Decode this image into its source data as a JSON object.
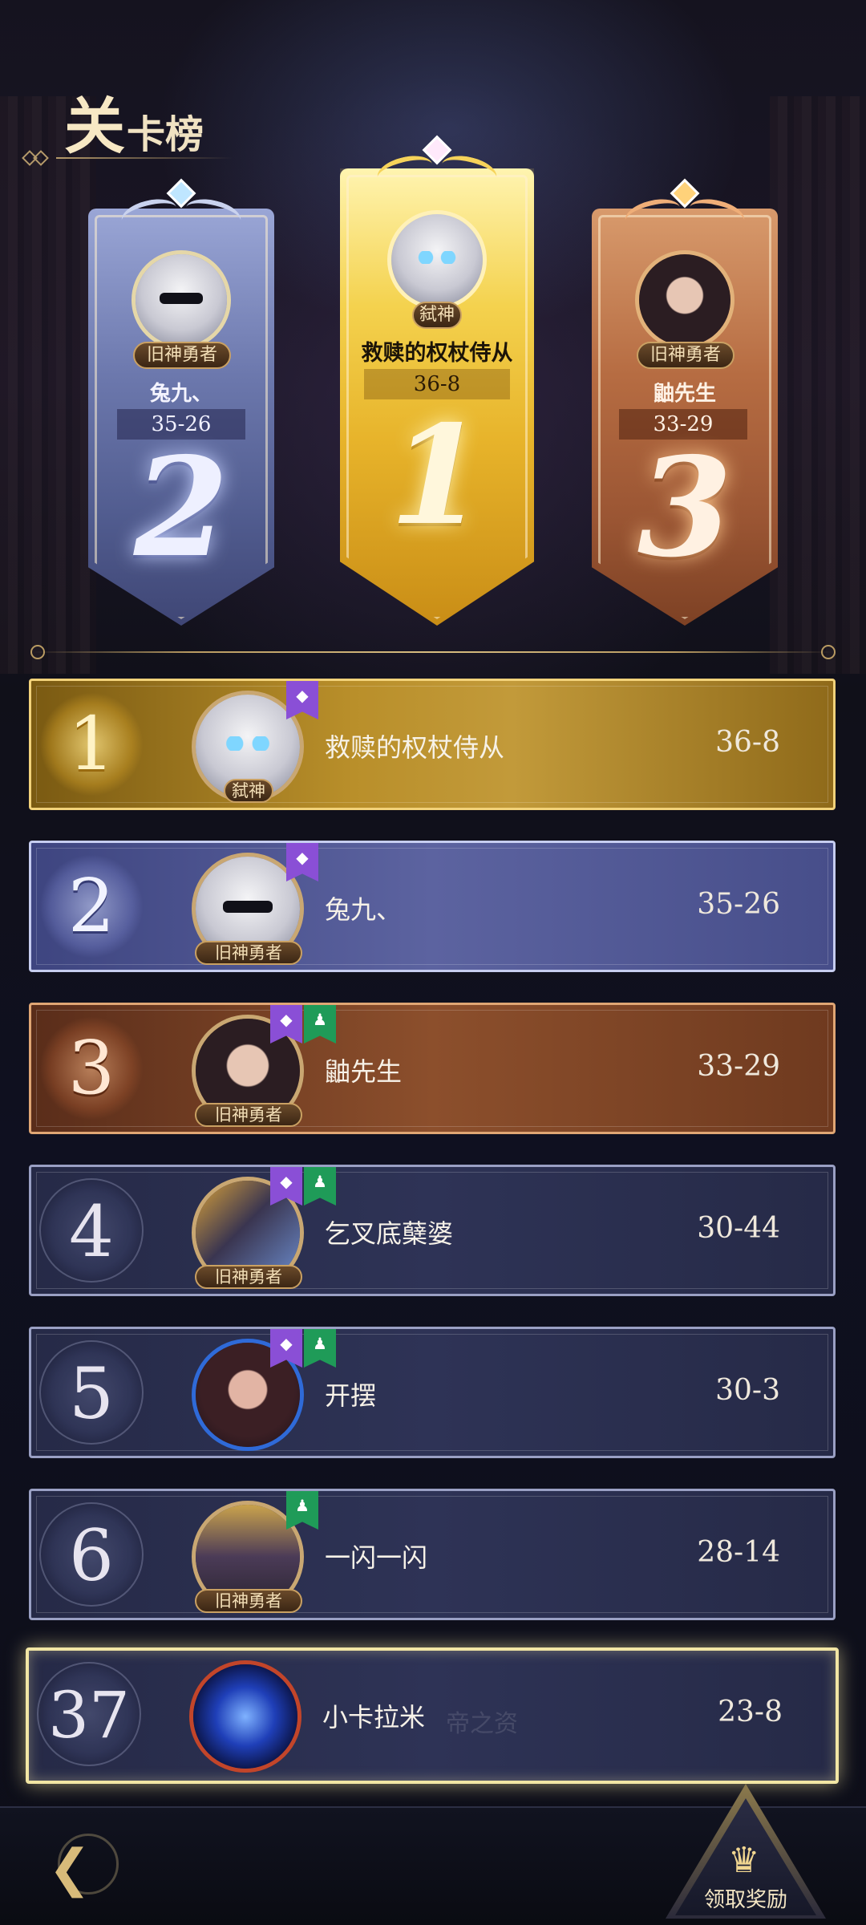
{
  "header": {
    "title_big": "关",
    "title_small": "卡榜"
  },
  "podium": [
    {
      "rank": "1",
      "name": "救赎的权杖侍从",
      "score": "36-8",
      "tag": "弑神",
      "avatar": "white-hair-blue-eyes"
    },
    {
      "rank": "2",
      "name": "兔九、",
      "score": "35-26",
      "tag": "旧神勇者",
      "avatar": "white-hair-sunglasses"
    },
    {
      "rank": "3",
      "name": "鼬先生",
      "score": "33-29",
      "tag": "旧神勇者",
      "avatar": "dark-hair-woman"
    }
  ],
  "leaderboard": [
    {
      "rank": "1",
      "name": "救赎的权杖侍从",
      "score": "36-8",
      "tag": "弑神",
      "badges": [
        "purple"
      ]
    },
    {
      "rank": "2",
      "name": "兔九、",
      "score": "35-26",
      "tag": "旧神勇者",
      "badges": [
        "purple"
      ]
    },
    {
      "rank": "3",
      "name": "鼬先生",
      "score": "33-29",
      "tag": "旧神勇者",
      "badges": [
        "purple",
        "green"
      ]
    },
    {
      "rank": "4",
      "name": "乞叉底蘖婆",
      "score": "30-44",
      "tag": "旧神勇者",
      "badges": [
        "purple",
        "green"
      ]
    },
    {
      "rank": "5",
      "name": "开摆",
      "score": "30-3",
      "tag": "",
      "badges": [
        "purple",
        "green"
      ]
    },
    {
      "rank": "6",
      "name": "一闪一闪",
      "score": "28-14",
      "tag": "旧神勇者",
      "badges": [
        "green"
      ]
    }
  ],
  "self_row": {
    "rank": "37",
    "name": "小卡拉米",
    "score": "23-8",
    "ghost_text": "帝之资"
  },
  "footer": {
    "back_icon": "chevron-left-icon",
    "reward_label": "领取奖励",
    "reward_icon": "treasure-chest-icon"
  },
  "colors": {
    "gold": "#e7b32a",
    "silver": "#6c78ad",
    "bronze": "#b66c42",
    "self_border": "#f2e6a4"
  }
}
